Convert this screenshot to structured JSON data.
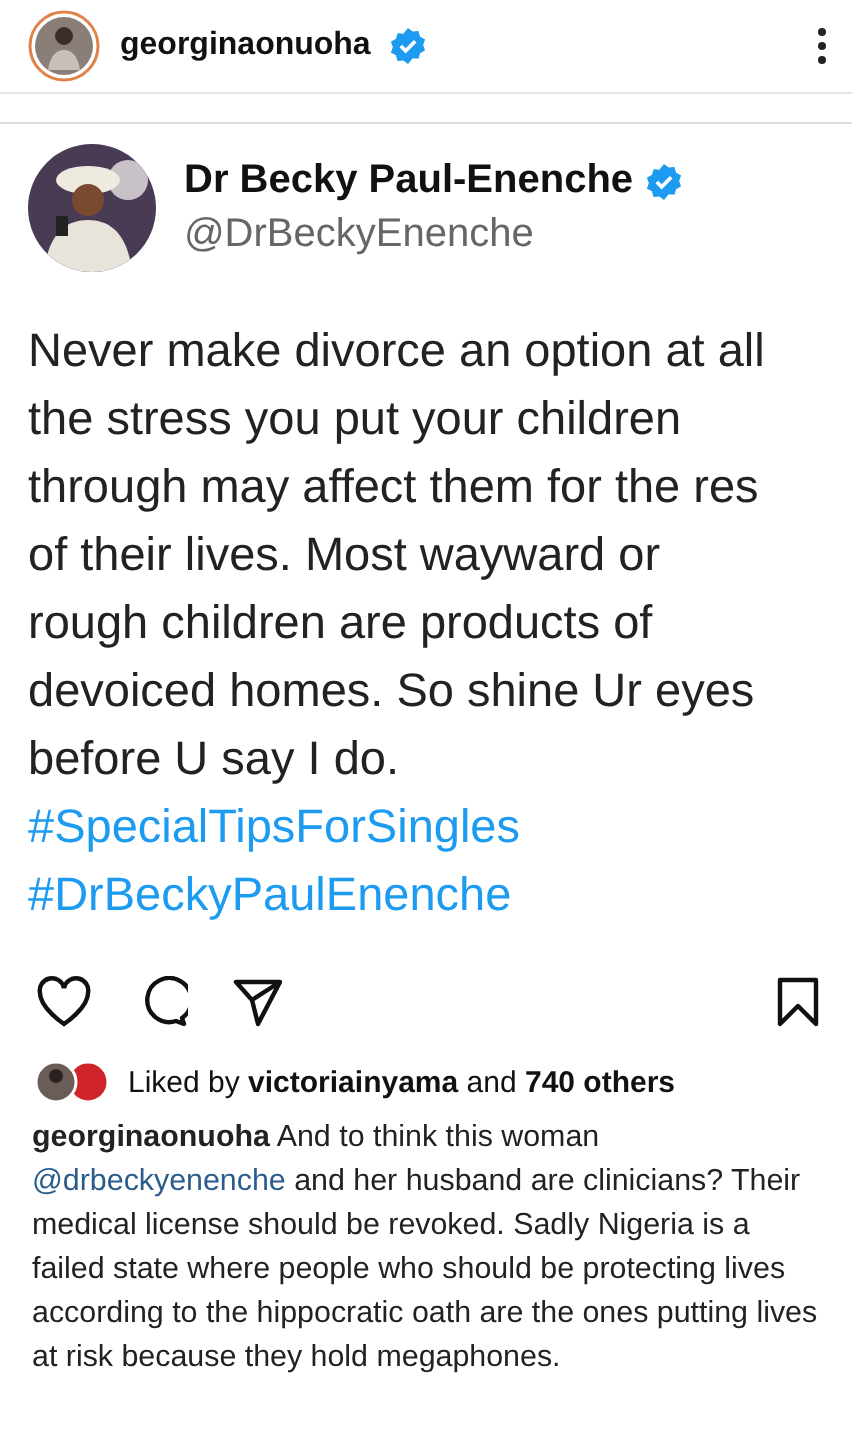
{
  "header": {
    "username": "georginaonuoha",
    "verified": true
  },
  "tweet": {
    "name": "Dr Becky Paul-Enenche",
    "verified": true,
    "handle": "@DrBeckyEnenche",
    "lines": [
      "Never make divorce an option at all",
      "the stress you put your children",
      "through may affect them for the res",
      "of their lives. Most wayward or",
      "rough children are products of",
      "devoiced homes. So shine Ur eyes",
      "before U say I do."
    ],
    "hashtags": [
      "#SpecialTipsForSingles",
      "#DrBeckyPaulEnenche"
    ]
  },
  "likes": {
    "prefix": "Liked by",
    "user": "victoriainyama",
    "middle": "and",
    "count": "740 others"
  },
  "caption": {
    "username": "georginaonuoha",
    "before": "And to think this woman",
    "mention": "@drbeckyenenche",
    "after": "and her husband are clinicians? Their medical license should be revoked. Sadly Nigeria is a failed state where people who should be protecting lives according to the hippocratic oath are the ones putting lives at risk because they hold megaphones."
  }
}
